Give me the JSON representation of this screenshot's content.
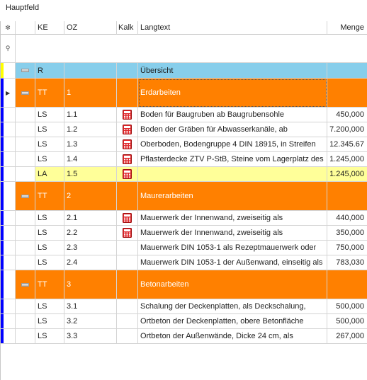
{
  "panel": {
    "title": "Hauptfeld"
  },
  "header": {
    "corner_glyph": "✻",
    "filter_glyph": "⚲",
    "columns": [
      "KE",
      "OZ",
      "Kalk",
      "Langtext",
      "Menge"
    ]
  },
  "colors": {
    "group": "#ff8000",
    "summary": "#87ceeb",
    "highlight": "#ffff99",
    "indicator_blue": "#0000ff",
    "indicator_yellow": "#ffff00",
    "calc_red": "#e0282c"
  },
  "rows": [
    {
      "kind": "summary",
      "ke": "R",
      "oz": "",
      "calc": false,
      "text": "Übersicht",
      "menge": ""
    },
    {
      "kind": "group",
      "ke": "TT",
      "oz": "1",
      "calc": false,
      "text": "Erdarbeiten",
      "menge": "",
      "selected": true
    },
    {
      "kind": "item",
      "ke": "LS",
      "oz": "1.1",
      "calc": true,
      "text": "Boden für Baugruben ab Baugrubensohle",
      "menge": "450,000"
    },
    {
      "kind": "item",
      "ke": "LS",
      "oz": "1.2",
      "calc": true,
      "text": "Boden der Gräben für Abwasserkanäle, ab",
      "menge": "7.200,000"
    },
    {
      "kind": "item",
      "ke": "LS",
      "oz": "1.3",
      "calc": true,
      "text": "Oberboden, Bodengruppe 4 DIN 18915, in Streifen",
      "menge": "12.345.67"
    },
    {
      "kind": "item",
      "ke": "LS",
      "oz": "1.4",
      "calc": true,
      "text": "Pflasterdecke ZTV P-StB, Steine vom Lagerplatz des",
      "menge": "1.245,000"
    },
    {
      "kind": "highlight",
      "ke": "LA",
      "oz": "1.5",
      "calc": true,
      "text": "",
      "menge": "1.245,000"
    },
    {
      "kind": "group",
      "ke": "TT",
      "oz": "2",
      "calc": false,
      "text": "Maurerarbeiten",
      "menge": ""
    },
    {
      "kind": "item",
      "ke": "LS",
      "oz": "2.1",
      "calc": true,
      "text": "Mauerwerk der Innenwand, zweiseitig als",
      "menge": "440,000"
    },
    {
      "kind": "item",
      "ke": "LS",
      "oz": "2.2",
      "calc": true,
      "text": "Mauerwerk der Innenwand, zweiseitig als",
      "menge": "350,000"
    },
    {
      "kind": "item",
      "ke": "LS",
      "oz": "2.3",
      "calc": false,
      "text": "Mauerwerk DIN 1053-1 als Rezeptmauerwerk oder",
      "menge": "750,000"
    },
    {
      "kind": "item",
      "ke": "LS",
      "oz": "2.4",
      "calc": false,
      "text": "Mauerwerk DIN 1053-1 der Außenwand, einseitig als",
      "menge": "783,030"
    },
    {
      "kind": "group",
      "ke": "TT",
      "oz": "3",
      "calc": false,
      "text": "Betonarbeiten",
      "menge": ""
    },
    {
      "kind": "item",
      "ke": "LS",
      "oz": "3.1",
      "calc": false,
      "text": "Schalung der Deckenplatten, als Deckschalung,",
      "menge": "500,000"
    },
    {
      "kind": "item",
      "ke": "LS",
      "oz": "3.2",
      "calc": false,
      "text": "Ortbeton der Deckenplatten, obere Betonfläche",
      "menge": "500,000"
    },
    {
      "kind": "item",
      "ke": "LS",
      "oz": "3.3",
      "calc": false,
      "text": "Ortbeton der Außenwände, Dicke 24 cm, als",
      "menge": "267,000"
    }
  ]
}
